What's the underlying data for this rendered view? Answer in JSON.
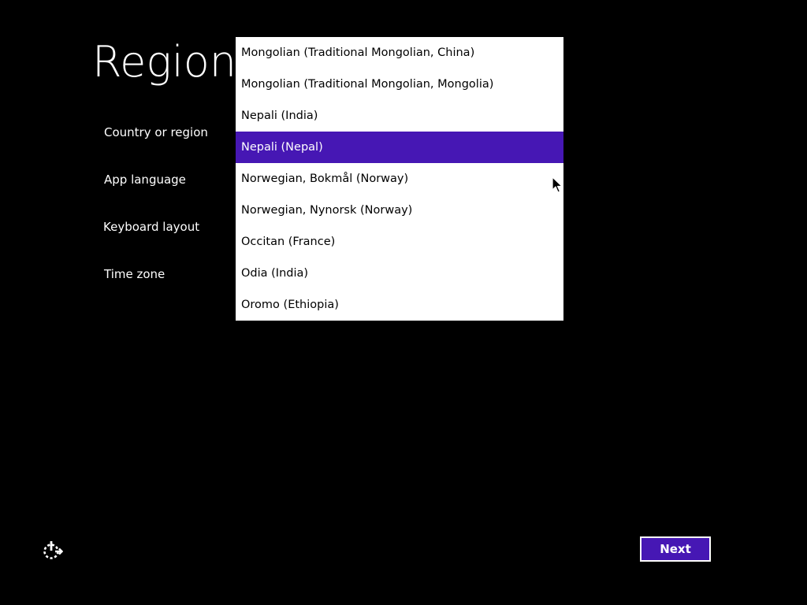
{
  "colors": {
    "background": "#000000",
    "accent": "#4617b4",
    "list_background": "#ffffff",
    "text_light": "#ffffff",
    "text_dark": "#000000"
  },
  "page": {
    "title": "Region"
  },
  "settings": {
    "country_label": "Country or region",
    "app_language_label": "App language",
    "keyboard_layout_label": "Keyboard layout",
    "time_zone_label": "Time zone"
  },
  "dropdown": {
    "items": [
      {
        "label": "Mongolian (Traditional Mongolian, China)",
        "selected": false
      },
      {
        "label": "Mongolian (Traditional Mongolian, Mongolia)",
        "selected": false
      },
      {
        "label": "Nepali (India)",
        "selected": false
      },
      {
        "label": "Nepali (Nepal)",
        "selected": true
      },
      {
        "label": "Norwegian, Bokmål (Norway)",
        "selected": false
      },
      {
        "label": "Norwegian, Nynorsk (Norway)",
        "selected": false
      },
      {
        "label": "Occitan (France)",
        "selected": false
      },
      {
        "label": "Odia (India)",
        "selected": false
      },
      {
        "label": "Oromo (Ethiopia)",
        "selected": false
      }
    ]
  },
  "footer": {
    "ease_of_access_icon": "ease-of-access-icon",
    "next_label": "Next"
  }
}
